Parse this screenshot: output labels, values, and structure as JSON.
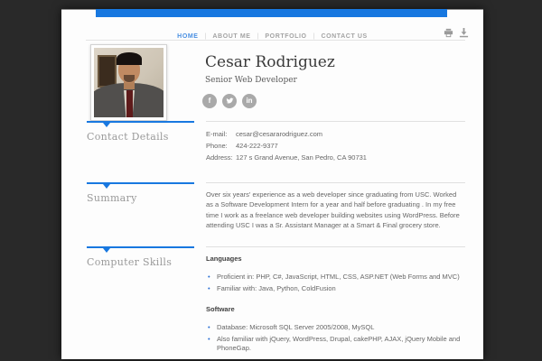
{
  "nav": {
    "items": [
      {
        "label": "HOME"
      },
      {
        "label": "ABOUT ME"
      },
      {
        "label": "PORTFOLIO"
      },
      {
        "label": "CONTACT US"
      }
    ]
  },
  "profile": {
    "name": "Cesar Rodriguez",
    "title": "Senior Web Developer",
    "social": [
      {
        "name": "facebook",
        "glyph": "f"
      },
      {
        "name": "twitter",
        "glyph": "t"
      },
      {
        "name": "linkedin",
        "glyph": "in"
      }
    ]
  },
  "sections": {
    "contact": {
      "label": "Contact Details",
      "rows": [
        {
          "label": "E-mail:",
          "value": "cesar@cesararodriguez.com"
        },
        {
          "label": "Phone:",
          "value": "424-222-9377"
        },
        {
          "label": "Address:",
          "value": "127 s Grand Avenue, San Pedro, CA 90731"
        }
      ]
    },
    "summary": {
      "label": "Summary",
      "text": "Over six years' experience as a web developer since graduating from USC. Worked as a Software Development Intern for a year and half before graduating . In my free time I work as a freelance web developer building websites using WordPress. Before attending USC I was a Sr. Assistant Manager at a Smart & Final grocery store."
    },
    "skills": {
      "label": "Computer Skills",
      "groups": [
        {
          "heading": "Languages",
          "bullets": [
            "Proficient in: PHP, C#, JavaScript, HTML, CSS, ASP.NET (Web Forms and MVC)",
            "Familiar with: Java, Python, ColdFusion"
          ]
        },
        {
          "heading": "Software",
          "bullets": [
            "Database: Microsoft SQL Server 2005/2008, MySQL",
            "Also familiar with jQuery, WordPress, Drupal, cakePHP, AJAX, jQuery Mobile and PhoneGap."
          ]
        }
      ]
    }
  },
  "colors": {
    "accent_blue": "#1878e0",
    "nav_active_blue": "#4a90e2",
    "bullet_blue": "#2a6fd4",
    "background_dark": "#292929"
  }
}
